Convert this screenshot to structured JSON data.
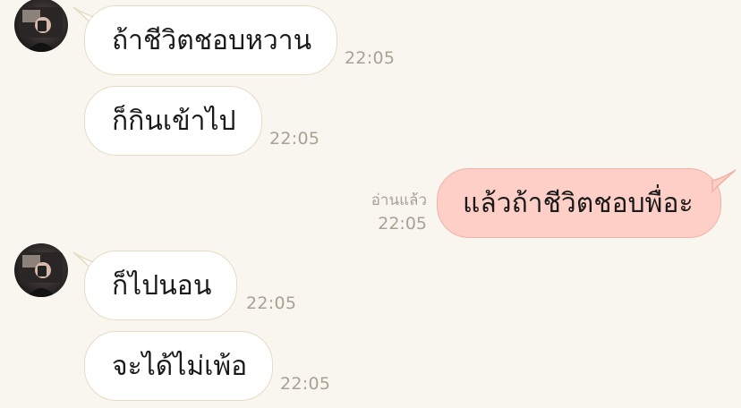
{
  "chat": {
    "messages": [
      {
        "sender": "other",
        "text": "ถ้าชีวิตชอบหวาน",
        "time": "22:05"
      },
      {
        "sender": "other",
        "text": "ก็กินเข้าไป",
        "time": "22:05"
      },
      {
        "sender": "me",
        "text": "แล้วถ้าชีวิตชอบพื่อะ",
        "time": "22:05",
        "read_label": "อ่านแล้ว"
      },
      {
        "sender": "other",
        "text": "ก็ไปนอน",
        "time": "22:05"
      },
      {
        "sender": "other",
        "text": "จะได้ไม่เพ้อ",
        "time": "22:05"
      }
    ]
  },
  "colors": {
    "background": "#f8f6ee",
    "incoming_bubble": "#ffffff",
    "incoming_border": "#e6dcc4",
    "outgoing_bubble": "#fdcfc6",
    "outgoing_border": "#f2b3a7",
    "timestamp": "#a8a294"
  }
}
